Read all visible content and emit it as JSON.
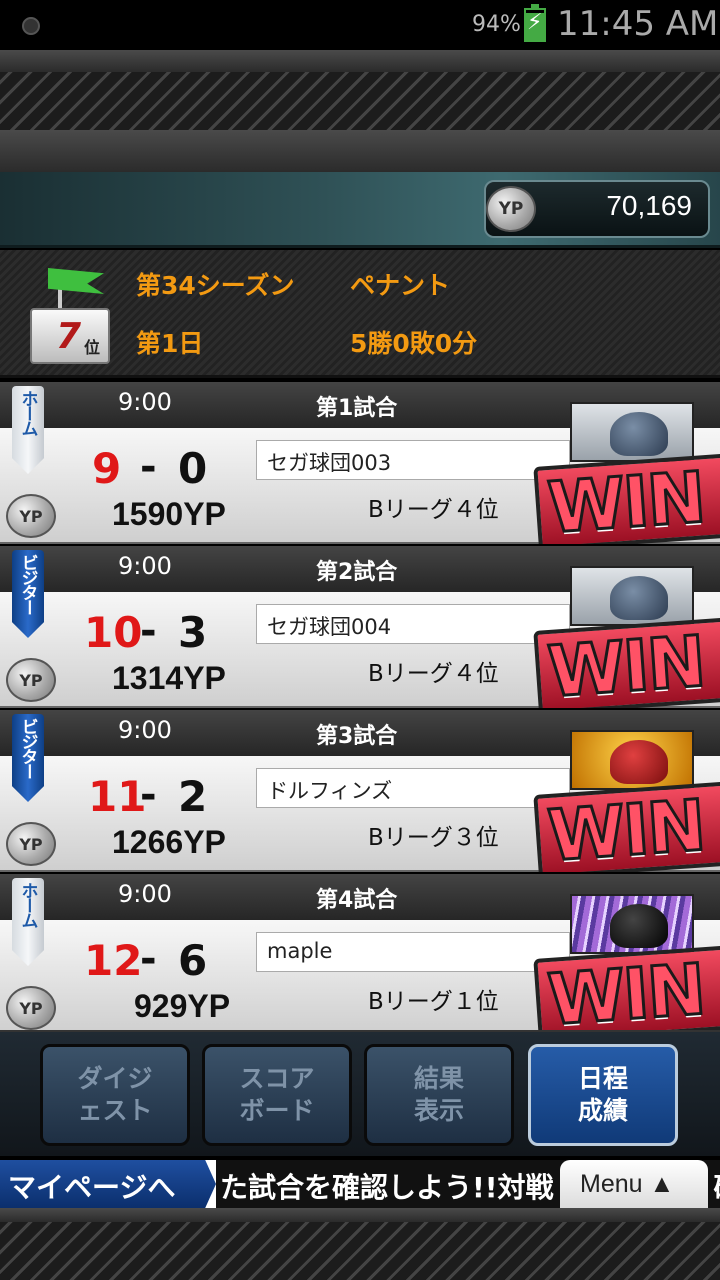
{
  "status_bar": {
    "battery_pct": "94%",
    "time": "11:45 AM"
  },
  "header": {
    "yp_icon": "YP",
    "yp_value": "70,169"
  },
  "season": {
    "rank_num": "7",
    "rank_suffix": "位",
    "season_label": "第34シーズン",
    "mode_label": "ペナント",
    "day_label": "第1日",
    "record_label": "5勝0敗0分"
  },
  "matches": [
    {
      "side": "ホーム",
      "side_type": "home",
      "time": "9:00",
      "game": "第1試合",
      "score_us": "9",
      "score_them": "0",
      "opponent": "セガ球団003",
      "yp": "1590YP",
      "league": "Bリーグ４位",
      "result": "WIN"
    },
    {
      "side": "ビジター",
      "side_type": "visitor",
      "time": "9:00",
      "game": "第2試合",
      "score_us": "10",
      "score_them": "3",
      "opponent": "セガ球団004",
      "yp": "1314YP",
      "league": "Bリーグ４位",
      "result": "WIN"
    },
    {
      "side": "ビジター",
      "side_type": "visitor",
      "time": "9:00",
      "game": "第3試合",
      "score_us": "11",
      "score_them": "2",
      "opponent": "ドルフィンズ",
      "yp": "1266YP",
      "league": "Bリーグ３位",
      "result": "WIN"
    },
    {
      "side": "ホーム",
      "side_type": "home",
      "time": "9:00",
      "game": "第4試合",
      "score_us": "12",
      "score_them": "6",
      "opponent": "maple",
      "yp": "929YP",
      "league": "Bリーグ１位",
      "result": "WIN"
    }
  ],
  "coin_label": "YP",
  "tabs": [
    {
      "label": "ダイジ\nェスト",
      "active": false
    },
    {
      "label": "スコア\nボード",
      "active": false
    },
    {
      "label": "結果\n表示",
      "active": false
    },
    {
      "label": "日程\n成績",
      "active": true
    }
  ],
  "ticker": {
    "mypage": "マイページへ",
    "text": "た試合を確認しよう!!対戦",
    "tail": "確"
  },
  "menu": {
    "label": "Menu ▲"
  }
}
